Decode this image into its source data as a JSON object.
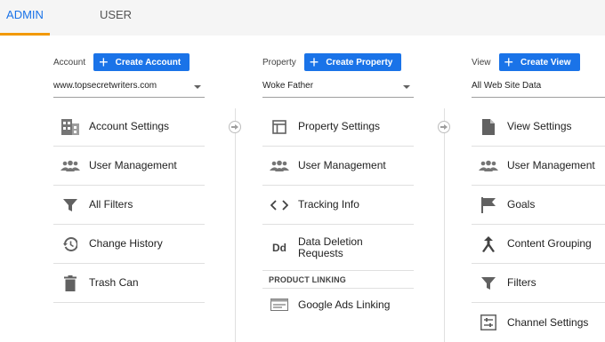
{
  "tabs": [
    {
      "label": "ADMIN",
      "active": true
    },
    {
      "label": "USER",
      "active": false
    }
  ],
  "colors": {
    "accent": "#1a73e8",
    "tab_underline": "#f29900",
    "icon": "#616161"
  },
  "account": {
    "label": "Account",
    "create_label": "Create Account",
    "selected": "www.topsecretwriters.com",
    "items": [
      {
        "label": "Account Settings",
        "icon": "building-icon"
      },
      {
        "label": "User Management",
        "icon": "people-icon"
      },
      {
        "label": "All Filters",
        "icon": "filter-icon"
      },
      {
        "label": "Change History",
        "icon": "history-icon"
      },
      {
        "label": "Trash Can",
        "icon": "trash-icon"
      }
    ]
  },
  "property": {
    "label": "Property",
    "create_label": "Create Property",
    "selected": "Woke Father",
    "items": [
      {
        "label": "Property Settings",
        "icon": "layout-icon"
      },
      {
        "label": "User Management",
        "icon": "people-icon"
      },
      {
        "label": "Tracking Info",
        "icon": "code-icon"
      },
      {
        "label": "Data Deletion Requests",
        "icon": "data-deletion-icon",
        "icon_text": "Dd"
      }
    ],
    "section_heading": "PRODUCT LINKING",
    "linking_items": [
      {
        "label": "Google Ads Linking",
        "icon": "ads-linking-icon"
      }
    ]
  },
  "view": {
    "label": "View",
    "create_label": "Create View",
    "selected": "All Web Site Data",
    "items": [
      {
        "label": "View Settings",
        "icon": "document-icon"
      },
      {
        "label": "User Management",
        "icon": "people-icon"
      },
      {
        "label": "Goals",
        "icon": "flag-icon"
      },
      {
        "label": "Content Grouping",
        "icon": "content-grouping-icon"
      },
      {
        "label": "Filters",
        "icon": "filter-icon"
      },
      {
        "label": "Channel Settings",
        "icon": "channel-settings-icon"
      }
    ]
  }
}
